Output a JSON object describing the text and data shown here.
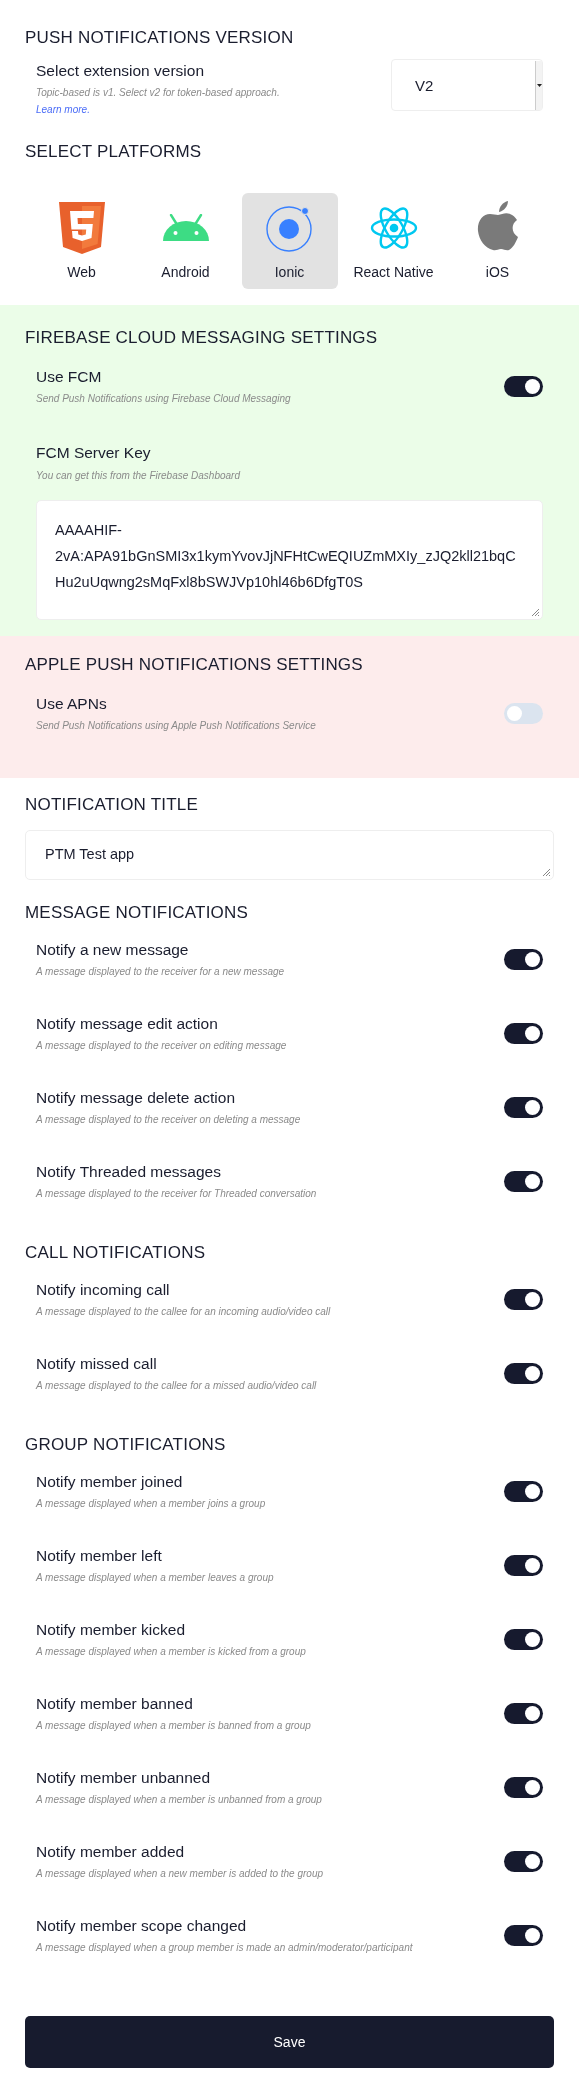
{
  "version_section": {
    "heading": "PUSH NOTIFICATIONS VERSION",
    "label": "Select extension version",
    "hint": "Topic-based is v1. Select v2 for token-based approach.",
    "link": "Learn more.",
    "select": {
      "value": "V2"
    }
  },
  "platforms_section": {
    "heading": "SELECT PLATFORMS",
    "platforms": [
      {
        "label": "Web",
        "selected": false
      },
      {
        "label": "Android",
        "selected": false
      },
      {
        "label": "Ionic",
        "selected": true
      },
      {
        "label": "React Native",
        "selected": false
      },
      {
        "label": "iOS",
        "selected": false
      }
    ]
  },
  "fcm_section": {
    "heading": "FIREBASE CLOUD MESSAGING SETTINGS",
    "setting": {
      "label": "Use FCM",
      "hint": "Send Push Notifications using Firebase Cloud Messaging",
      "on": true
    },
    "key_field": {
      "label": "FCM Server Key",
      "hint": "You can get this from the Firebase Dashboard",
      "value": "AAAAHIF-2vA:APA91bGnSMI3x1kymYvovJjNFHtCwEQIUZmMXIy_zJQ2kll21bqCHu2uUqwng2sMqFxl8bSWJVp10hl46b6DfgT0S"
    }
  },
  "apns_section": {
    "heading": "APPLE PUSH NOTIFICATIONS SETTINGS",
    "setting": {
      "label": "Use APNs",
      "hint": "Send Push Notifications using Apple Push Notifications Service",
      "on": false
    }
  },
  "title_section": {
    "heading": "NOTIFICATION TITLE",
    "value": "PTM Test app"
  },
  "message_notifications": {
    "heading": "MESSAGE NOTIFICATIONS",
    "items": [
      {
        "label": "Notify a new message",
        "hint": "A message displayed to the receiver for a new message",
        "on": true
      },
      {
        "label": "Notify message edit action",
        "hint": "A message displayed to the receiver on editing message",
        "on": true
      },
      {
        "label": "Notify message delete action",
        "hint": "A message displayed to the receiver on deleting a message",
        "on": true
      },
      {
        "label": "Notify Threaded messages",
        "hint": "A message displayed to the receiver for Threaded conversation",
        "on": true
      }
    ]
  },
  "call_notifications": {
    "heading": "CALL NOTIFICATIONS",
    "items": [
      {
        "label": "Notify incoming call",
        "hint": "A message displayed to the callee for an incoming audio/video call",
        "on": true
      },
      {
        "label": "Notify missed call",
        "hint": "A message displayed to the callee for a missed audio/video call",
        "on": true
      }
    ]
  },
  "group_notifications": {
    "heading": "GROUP NOTIFICATIONS",
    "items": [
      {
        "label": "Notify member joined",
        "hint": "A message displayed when a member joins a group",
        "on": true
      },
      {
        "label": "Notify member left",
        "hint": "A message displayed when a member leaves a group",
        "on": true
      },
      {
        "label": "Notify member kicked",
        "hint": "A message displayed when a member is kicked from a group",
        "on": true
      },
      {
        "label": "Notify member banned",
        "hint": "A message displayed when a member is banned from a group",
        "on": true
      },
      {
        "label": "Notify member unbanned",
        "hint": "A message displayed when a member is unbanned from a group",
        "on": true
      },
      {
        "label": "Notify member added",
        "hint": "A message displayed when a new member is added to the group",
        "on": true
      },
      {
        "label": "Notify member scope changed",
        "hint": "A message displayed when a group member is made an admin/moderator/participant",
        "on": true
      }
    ]
  },
  "save_button": {
    "label": "Save"
  }
}
